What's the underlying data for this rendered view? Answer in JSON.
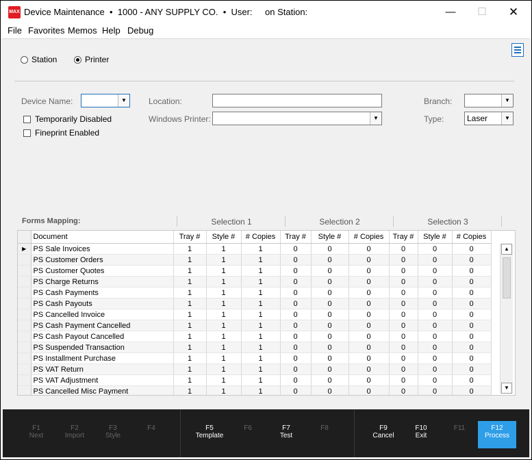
{
  "window": {
    "title_main": "Device Maintenance  •  1000 - ANY SUPPLY CO.  •  User:",
    "title_station": "on Station:",
    "icon_text": "MAX"
  },
  "menu": [
    "File",
    "Favorites",
    "Memos",
    "Help",
    "Debug"
  ],
  "device_type": {
    "options": [
      "Station",
      "Printer"
    ],
    "selected": "Printer"
  },
  "form": {
    "device_name_label": "Device Name:",
    "device_name_value": "",
    "temporarily_disabled_label": "Temporarily Disabled",
    "temporarily_disabled": false,
    "fineprint_enabled_label": "Fineprint Enabled",
    "fineprint_enabled": false,
    "location_label": "Location:",
    "location_value": "",
    "windows_printer_label": "Windows Printer:",
    "windows_printer_value": "",
    "branch_label": "Branch:",
    "branch_value": "",
    "type_label": "Type:",
    "type_value": "Laser"
  },
  "forms_mapping": {
    "title": "Forms Mapping:",
    "selections": [
      "Selection 1",
      "Selection 2",
      "Selection 3"
    ],
    "columns": [
      "Document",
      "Tray #",
      "Style #",
      "# Copies",
      "Tray #",
      "Style #",
      "# Copies",
      "Tray #",
      "Style #",
      "# Copies"
    ],
    "rows": [
      [
        "PS Sale Invoices",
        "1",
        "1",
        "1",
        "0",
        "0",
        "0",
        "0",
        "0",
        "0"
      ],
      [
        "PS Customer Orders",
        "1",
        "1",
        "1",
        "0",
        "0",
        "0",
        "0",
        "0",
        "0"
      ],
      [
        "PS Customer Quotes",
        "1",
        "1",
        "1",
        "0",
        "0",
        "0",
        "0",
        "0",
        "0"
      ],
      [
        "PS Charge Returns",
        "1",
        "1",
        "1",
        "0",
        "0",
        "0",
        "0",
        "0",
        "0"
      ],
      [
        "PS Cash Payments",
        "1",
        "1",
        "1",
        "0",
        "0",
        "0",
        "0",
        "0",
        "0"
      ],
      [
        "PS Cash Payouts",
        "1",
        "1",
        "1",
        "0",
        "0",
        "0",
        "0",
        "0",
        "0"
      ],
      [
        "PS Cancelled Invoice",
        "1",
        "1",
        "1",
        "0",
        "0",
        "0",
        "0",
        "0",
        "0"
      ],
      [
        "PS Cash Payment Cancelled",
        "1",
        "1",
        "1",
        "0",
        "0",
        "0",
        "0",
        "0",
        "0"
      ],
      [
        "PS Cash Payout Cancelled",
        "1",
        "1",
        "1",
        "0",
        "0",
        "0",
        "0",
        "0",
        "0"
      ],
      [
        "PS Suspended Transaction",
        "1",
        "1",
        "1",
        "0",
        "0",
        "0",
        "0",
        "0",
        "0"
      ],
      [
        "PS Installment Purchase",
        "1",
        "1",
        "1",
        "0",
        "0",
        "0",
        "0",
        "0",
        "0"
      ],
      [
        "PS VAT Return",
        "1",
        "1",
        "1",
        "0",
        "0",
        "0",
        "0",
        "0",
        "0"
      ],
      [
        "PS VAT Adjustment",
        "1",
        "1",
        "1",
        "0",
        "0",
        "0",
        "0",
        "0",
        "0"
      ],
      [
        "PS Cancelled Misc Payment",
        "1",
        "1",
        "1",
        "0",
        "0",
        "0",
        "0",
        "0",
        "0"
      ]
    ]
  },
  "function_keys": [
    {
      "key": "F1",
      "label": "Next",
      "enabled": false
    },
    {
      "key": "F2",
      "label": "Import",
      "enabled": false
    },
    {
      "key": "F3",
      "label": "Style",
      "enabled": false
    },
    {
      "key": "F4",
      "label": "",
      "enabled": false
    },
    {
      "key": "F5",
      "label": "Template",
      "enabled": true
    },
    {
      "key": "F6",
      "label": "",
      "enabled": false
    },
    {
      "key": "F7",
      "label": "Test",
      "enabled": true
    },
    {
      "key": "F8",
      "label": "",
      "enabled": false
    },
    {
      "key": "F9",
      "label": "Cancel",
      "enabled": true
    },
    {
      "key": "F10",
      "label": "Exit",
      "enabled": true
    },
    {
      "key": "F11",
      "label": "",
      "enabled": false
    },
    {
      "key": "F12",
      "label": "Process",
      "enabled": true,
      "primary": true
    }
  ],
  "colors": {
    "accent": "#2e9ee8",
    "fkey_bar": "#1e1e1e",
    "app_icon": "#e01c24"
  }
}
